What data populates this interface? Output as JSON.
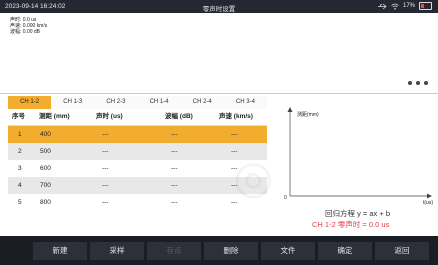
{
  "status_bar": {
    "datetime": "2023-09-14 16:24:02",
    "title": "零声时设置",
    "battery": "17%"
  },
  "info": {
    "line1": "声时: 0.0 us",
    "line2": "声速: 0.000 km/s",
    "line3": "波幅: 0.00 dB"
  },
  "tabs": [
    "CH 1-2",
    "CH 1-3",
    "CH 2-3",
    "CH 1-4",
    "CH 2-4",
    "CH 3-4"
  ],
  "table": {
    "headers": [
      "序号",
      "测距 (mm)",
      "声时 (us)",
      "波幅 (dB)",
      "声速 (km/s)"
    ],
    "rows": [
      [
        "1",
        "400",
        "---",
        "---",
        "---"
      ],
      [
        "2",
        "500",
        "---",
        "---",
        "---"
      ],
      [
        "3",
        "600",
        "---",
        "---",
        "---"
      ],
      [
        "4",
        "700",
        "---",
        "---",
        "---"
      ],
      [
        "5",
        "800",
        "---",
        "---",
        "---"
      ]
    ],
    "selected_row": 0
  },
  "chart_data": {
    "type": "scatter",
    "ylabel": "测距(mm)",
    "xlabel": "t(us)",
    "origin_label": "0",
    "series": []
  },
  "regression": {
    "equation": "回归方程 y = ax + b",
    "zero_time": "CH 1-2 零声时 = 0.0 us"
  },
  "toolbar": [
    "新建",
    "采样",
    "存点",
    "删除",
    "文件",
    "确定",
    "返回"
  ],
  "colors": {
    "accent": "#f2ad2e",
    "statusbar": "#252833",
    "toolbar": "#1b1d24",
    "zero_time": "#e2414b"
  }
}
